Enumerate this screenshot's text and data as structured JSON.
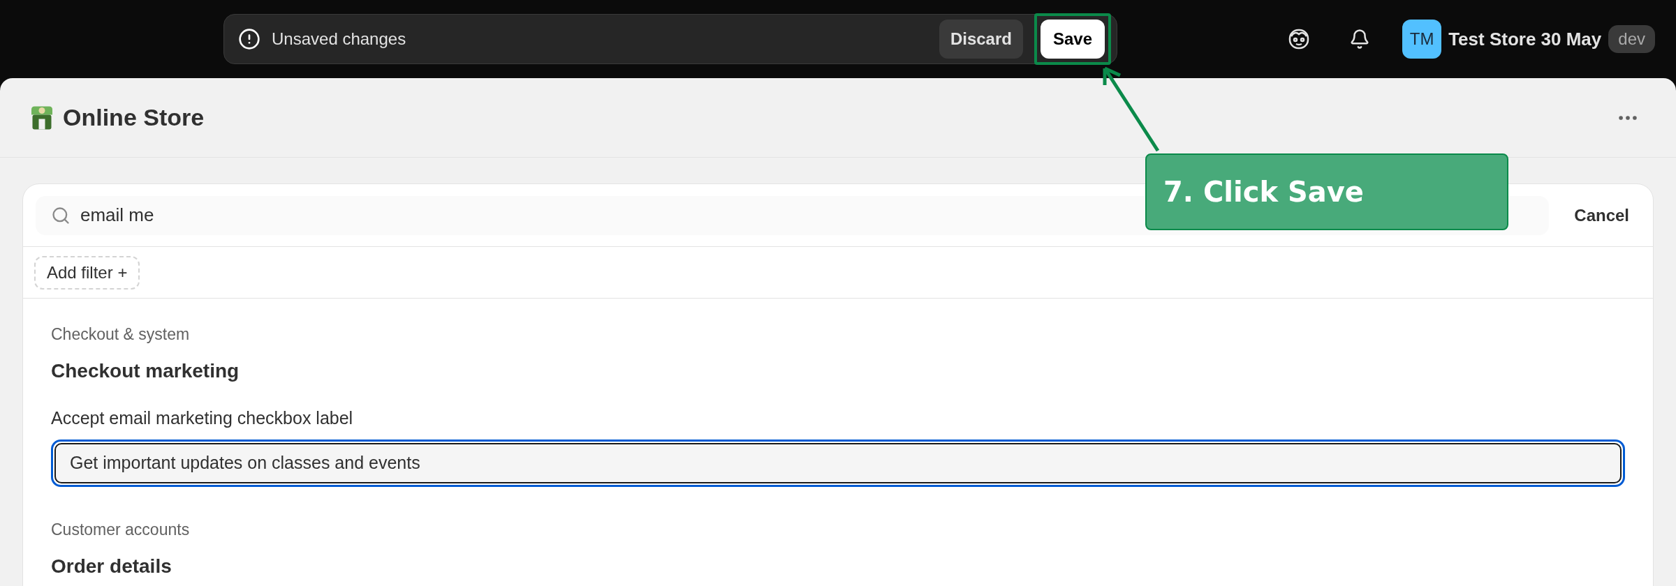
{
  "topbar": {
    "unsaved_message": "Unsaved changes",
    "discard_button": "Discard",
    "save_button": "Save",
    "save_highlighted": true,
    "store": {
      "initials": "TM",
      "name": "Test Store 30 May",
      "badge": "dev"
    }
  },
  "header": {
    "title": "Online Store"
  },
  "search": {
    "value": "email me",
    "cancel": "Cancel"
  },
  "filter_button": "Add filter +",
  "sections": [
    {
      "category": "Checkout & system",
      "title": "Checkout marketing",
      "field_label": "Accept email marketing checkbox label",
      "field_value": "Get important updates on classes and events",
      "focused": true
    },
    {
      "category": "Customer accounts",
      "title": "Order details"
    }
  ],
  "callout": {
    "text": "7. Click Save"
  }
}
